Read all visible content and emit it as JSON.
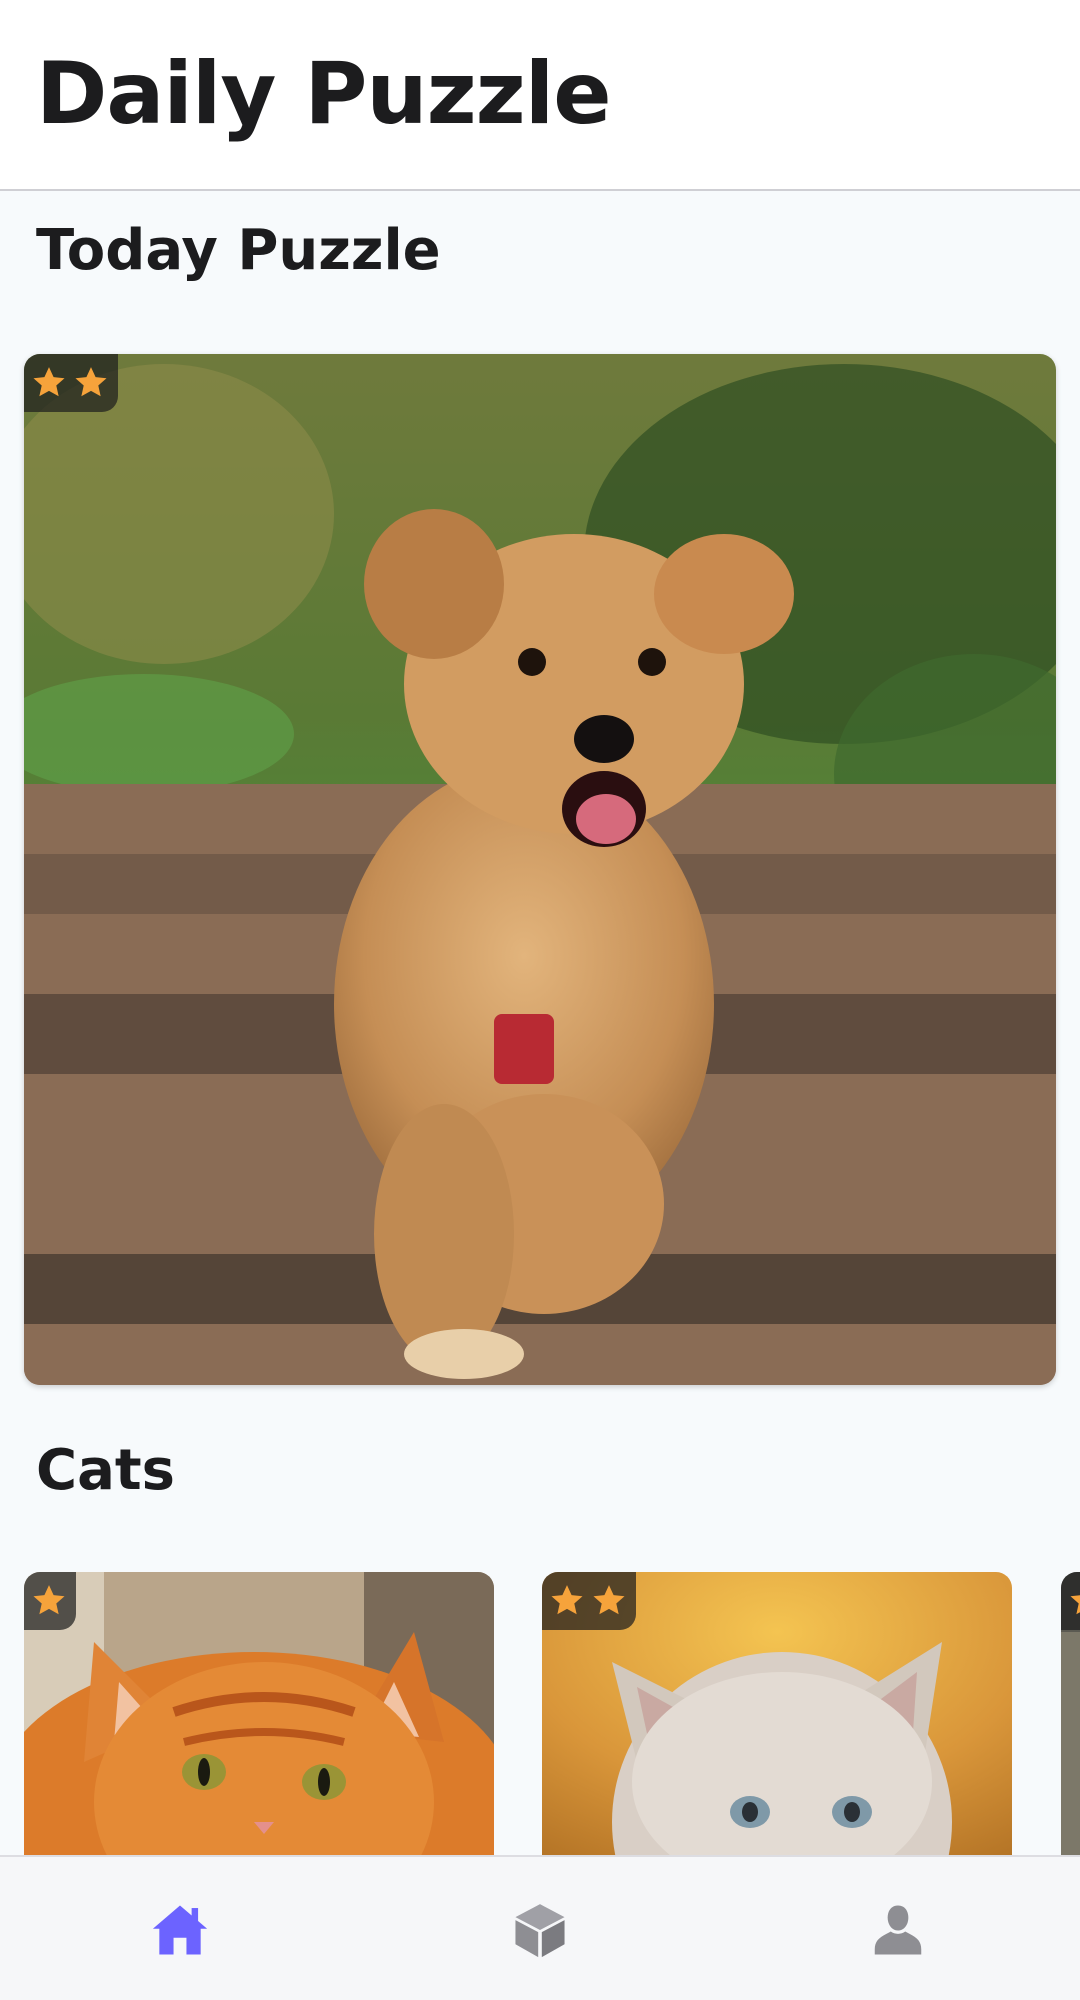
{
  "app": {
    "title": "Daily Puzzle"
  },
  "sections": {
    "today": {
      "title": "Today Puzzle",
      "difficulty_stars": 2,
      "image": "running-dog-photo"
    },
    "cats": {
      "title": "Cats",
      "items": [
        {
          "image": "orange-tabby-cat-photo",
          "difficulty_stars": 1
        },
        {
          "image": "white-kitten-photo",
          "difficulty_stars": 2
        },
        {
          "image": "partial-cat-photo",
          "difficulty_stars": 1
        }
      ]
    }
  },
  "bottom_nav": {
    "items": [
      {
        "icon": "home-icon",
        "active": true
      },
      {
        "icon": "cube-icon",
        "active": false
      },
      {
        "icon": "profile-icon",
        "active": false
      }
    ],
    "active_color": "#6c63ff",
    "inactive_color": "#8e8e93"
  },
  "colors": {
    "star": "#f6a33b",
    "badge_bg": "#1e1e1e"
  }
}
